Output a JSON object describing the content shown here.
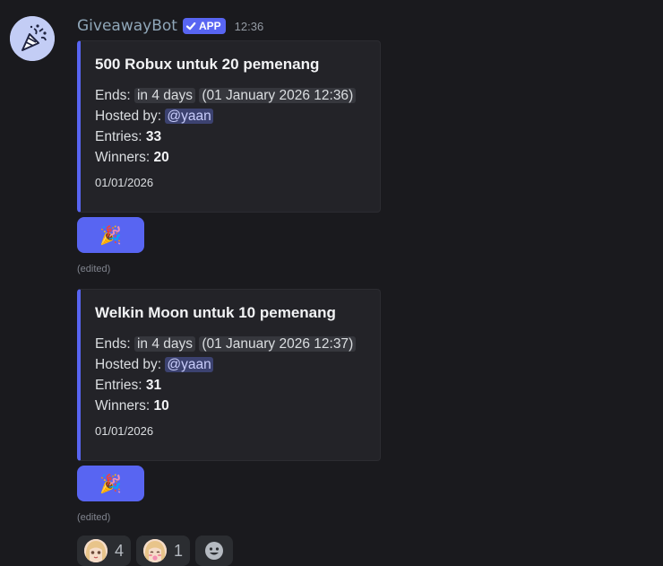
{
  "message": {
    "author": "GiveawayBot",
    "badge": "APP",
    "time": "12:36",
    "avatar_icon": "party-popper-icon"
  },
  "giveaways": [
    {
      "title": "500 Robux untuk 20 pemenang",
      "ends_label": "Ends:",
      "ends_relative": "in 4 days",
      "ends_absolute": "01 January 2026 12:36",
      "hosted_label": "Hosted by:",
      "host": "@yaan",
      "entries_label": "Entries:",
      "entries": "33",
      "winners_label": "Winners:",
      "winners": "20",
      "footer": "01/01/2026",
      "button_emoji": "🎉",
      "edited": "(edited)"
    },
    {
      "title": "Welkin Moon untuk 10 pemenang",
      "ends_label": "Ends:",
      "ends_relative": "in 4 days",
      "ends_absolute": "01 January 2026 12:37",
      "hosted_label": "Hosted by:",
      "host": "@yaan",
      "entries_label": "Entries:",
      "entries": "31",
      "winners_label": "Winners:",
      "winners": "10",
      "footer": "01/01/2026",
      "button_emoji": "🎉",
      "edited": "(edited)"
    }
  ],
  "reactions": [
    {
      "emoji": "anime-girl-emoji",
      "count": "4"
    },
    {
      "emoji": "anime-girl-blush-emoji",
      "count": "1"
    }
  ],
  "add_reaction_icon": "smiley-icon",
  "colors": {
    "accent": "#5865f2",
    "background": "#1a1a1e",
    "embed": "#232328",
    "mention": "#c9cdfb"
  }
}
